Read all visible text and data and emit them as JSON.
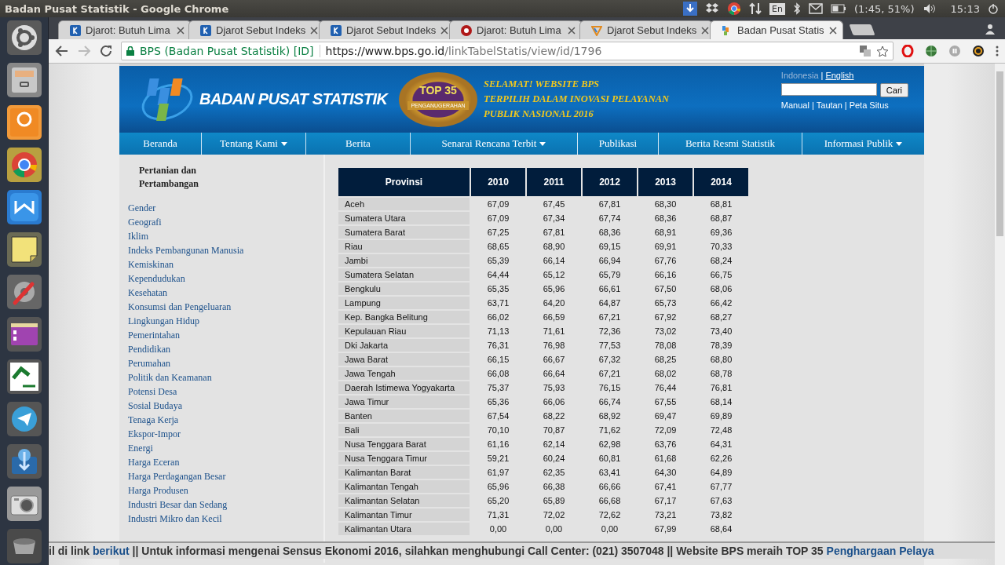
{
  "top_panel": {
    "title": "Badan Pusat Statistik - Google Chrome",
    "keyboard": "En",
    "battery": "(1:45, 51%)",
    "clock": "15:13"
  },
  "launcher": [
    {
      "kind": "ubuntu"
    },
    {
      "kind": "cabinet"
    },
    {
      "kind": "pdf"
    },
    {
      "kind": "chrome"
    },
    {
      "kind": "writer"
    },
    {
      "kind": "note"
    },
    {
      "kind": "settings"
    },
    {
      "kind": "purple"
    },
    {
      "kind": "ayat"
    },
    {
      "kind": "telegram"
    },
    {
      "kind": "download"
    },
    {
      "kind": "camera"
    },
    {
      "kind": "trash"
    }
  ],
  "tabs": [
    {
      "label": "Djarot: Butuh Lima",
      "kind": "k",
      "selected": false
    },
    {
      "label": "Djarot Sebut Indeks",
      "kind": "k",
      "selected": false
    },
    {
      "label": "Djarot Sebut Indeks",
      "kind": "k",
      "selected": false
    },
    {
      "label": "Djarot: Butuh Lima",
      "kind": "red",
      "selected": false
    },
    {
      "label": "Djarot Sebut Indeks",
      "kind": "tri",
      "selected": false
    },
    {
      "label": "Badan Pusat Statis",
      "kind": "bps",
      "selected": true
    }
  ],
  "address": {
    "site": "BPS (Badan Pusat Statistik) [ID]",
    "host": "https://www.bps.go.id",
    "path": "/linkTabelStatis/view/id/1796"
  },
  "header": {
    "brand": "BADAN PUSAT STATISTIK",
    "award_title": "TOP 35",
    "award_ribbon": "PENGANUGERAHAN",
    "promo": [
      "SELAMAT! WEBSITE BPS",
      "TERPILIH DALAM INOVASI PELAYANAN",
      "PUBLIK NASIONAL 2016"
    ],
    "languages": [
      {
        "label": "Indonesia",
        "selected": true
      },
      {
        "label": "English",
        "selected": false
      }
    ],
    "search_button": "Cari",
    "separator": "|",
    "links": [
      "Manual",
      "Tautan",
      "Peta Situs"
    ]
  },
  "nav": [
    {
      "label": "Beranda",
      "dropdown": false
    },
    {
      "label": "Tentang Kami",
      "dropdown": true
    },
    {
      "label": "Berita",
      "dropdown": false
    },
    {
      "label": "Senarai Rencana Terbit",
      "dropdown": true
    },
    {
      "label": "Publikasi",
      "dropdown": false
    },
    {
      "label": "Berita Resmi Statistik",
      "dropdown": false
    },
    {
      "label": "Informasi Publik",
      "dropdown": true
    }
  ],
  "sidebar": {
    "heading": "Pertanian dan Pertambangan",
    "items": [
      "Gender",
      "Geografi",
      "Iklim",
      "Indeks Pembangunan Manusia",
      "Kemiskinan",
      "Kependudukan",
      "Kesehatan",
      "Konsumsi dan Pengeluaran",
      "Lingkungan Hidup",
      "Pemerintahan",
      "Pendidikan",
      "Perumahan",
      "Politik dan Keamanan",
      "Potensi Desa",
      "Sosial Budaya",
      "Tenaga Kerja",
      "Ekspor-Impor",
      "Energi",
      "Harga Eceran",
      "Harga Perdagangan Besar",
      "Harga Produsen",
      "Industri Besar dan Sedang",
      "Industri Mikro dan Kecil"
    ]
  },
  "table": {
    "columns": [
      "Provinsi",
      "2010",
      "2011",
      "2012",
      "2013",
      "2014"
    ],
    "rows": [
      [
        "Aceh",
        "67,09",
        "67,45",
        "67,81",
        "68,30",
        "68,81"
      ],
      [
        "Sumatera Utara",
        "67,09",
        "67,34",
        "67,74",
        "68,36",
        "68,87"
      ],
      [
        "Sumatera Barat",
        "67,25",
        "67,81",
        "68,36",
        "68,91",
        "69,36"
      ],
      [
        "Riau",
        "68,65",
        "68,90",
        "69,15",
        "69,91",
        "70,33"
      ],
      [
        "Jambi",
        "65,39",
        "66,14",
        "66,94",
        "67,76",
        "68,24"
      ],
      [
        "Sumatera Selatan",
        "64,44",
        "65,12",
        "65,79",
        "66,16",
        "66,75"
      ],
      [
        "Bengkulu",
        "65,35",
        "65,96",
        "66,61",
        "67,50",
        "68,06"
      ],
      [
        "Lampung",
        "63,71",
        "64,20",
        "64,87",
        "65,73",
        "66,42"
      ],
      [
        "Kep. Bangka Belitung",
        "66,02",
        "66,59",
        "67,21",
        "67,92",
        "68,27"
      ],
      [
        "Kepulauan Riau",
        "71,13",
        "71,61",
        "72,36",
        "73,02",
        "73,40"
      ],
      [
        "Dki Jakarta",
        "76,31",
        "76,98",
        "77,53",
        "78,08",
        "78,39"
      ],
      [
        "Jawa Barat",
        "66,15",
        "66,67",
        "67,32",
        "68,25",
        "68,80"
      ],
      [
        "Jawa Tengah",
        "66,08",
        "66,64",
        "67,21",
        "68,02",
        "68,78"
      ],
      [
        "Daerah Istimewa Yogyakarta",
        "75,37",
        "75,93",
        "76,15",
        "76,44",
        "76,81"
      ],
      [
        "Jawa Timur",
        "65,36",
        "66,06",
        "66,74",
        "67,55",
        "68,14"
      ],
      [
        "Banten",
        "67,54",
        "68,22",
        "68,92",
        "69,47",
        "69,89"
      ],
      [
        "Bali",
        "70,10",
        "70,87",
        "71,62",
        "72,09",
        "72,48"
      ],
      [
        "Nusa Tenggara Barat",
        "61,16",
        "62,14",
        "62,98",
        "63,76",
        "64,31"
      ],
      [
        "Nusa Tenggara Timur",
        "59,21",
        "60,24",
        "60,81",
        "61,68",
        "62,26"
      ],
      [
        "Kalimantan Barat",
        "61,97",
        "62,35",
        "63,41",
        "64,30",
        "64,89"
      ],
      [
        "Kalimantan Tengah",
        "65,96",
        "66,38",
        "66,66",
        "67,41",
        "67,77"
      ],
      [
        "Kalimantan Selatan",
        "65,20",
        "65,89",
        "66,68",
        "67,17",
        "67,63"
      ],
      [
        "Kalimantan Timur",
        "71,31",
        "72,02",
        "72,62",
        "73,21",
        "73,82"
      ],
      [
        "Kalimantan Utara",
        "0,00",
        "0,00",
        "0,00",
        "67,99",
        "68,64"
      ]
    ]
  },
  "ticker": [
    {
      "kind": "text",
      "text": "il di link"
    },
    {
      "kind": "link",
      "text": "berikut"
    },
    {
      "kind": "text",
      "text": "|| Untuk informasi mengenai Sensus Ekonomi 2016, silahkan menghubungi Call Center: (021) 3507048 || Website BPS meraih TOP 35"
    },
    {
      "kind": "link",
      "text": "Penghargaan Pelaya"
    }
  ]
}
